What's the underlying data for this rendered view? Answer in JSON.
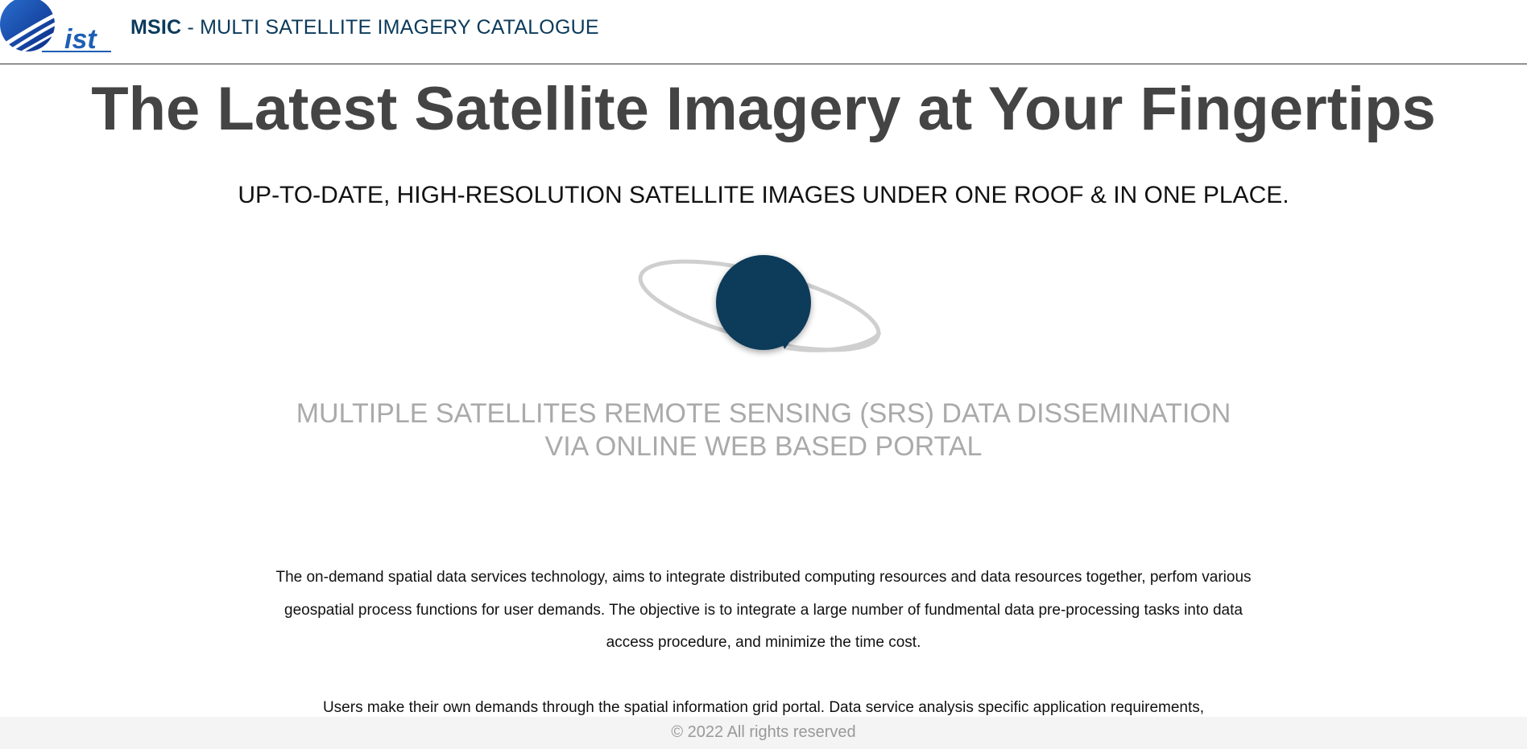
{
  "header": {
    "brand_abbr": "MSIC",
    "brand_rest": " - MULTI SATELLITE IMAGERY CATALOGUE"
  },
  "hero": {
    "title": "The Latest Satellite Imagery at Your Fingertips",
    "subtitle": "UP-TO-DATE, HIGH-RESOLUTION SATELLITE IMAGES UNDER ONE ROOF & IN ONE PLACE."
  },
  "srs_heading_line1": "MULTIPLE SATELLITES REMOTE SENSING (SRS) DATA DISSEMINATION",
  "srs_heading_line2": "VIA ONLINE WEB BASED PORTAL",
  "paragraphs": [
    "The on-demand spatial data services technology, aims to integrate distributed computing resources and data resources together, perfom various geospatial process functions for user demands. The objective is to integrate a large number of fundmental data pre-processing tasks into data access procedure, and minimize the time cost.",
    "Users make their own demands through the spatial information grid portal. Data service analysis specific application requirements,"
  ],
  "footer": {
    "copyright": "© 2022 All rights reserved"
  },
  "colors": {
    "brand": "#0b3a5b",
    "planet": "#0a3a5a",
    "ring": "#cccccc",
    "muted": "#aaaaaa"
  }
}
